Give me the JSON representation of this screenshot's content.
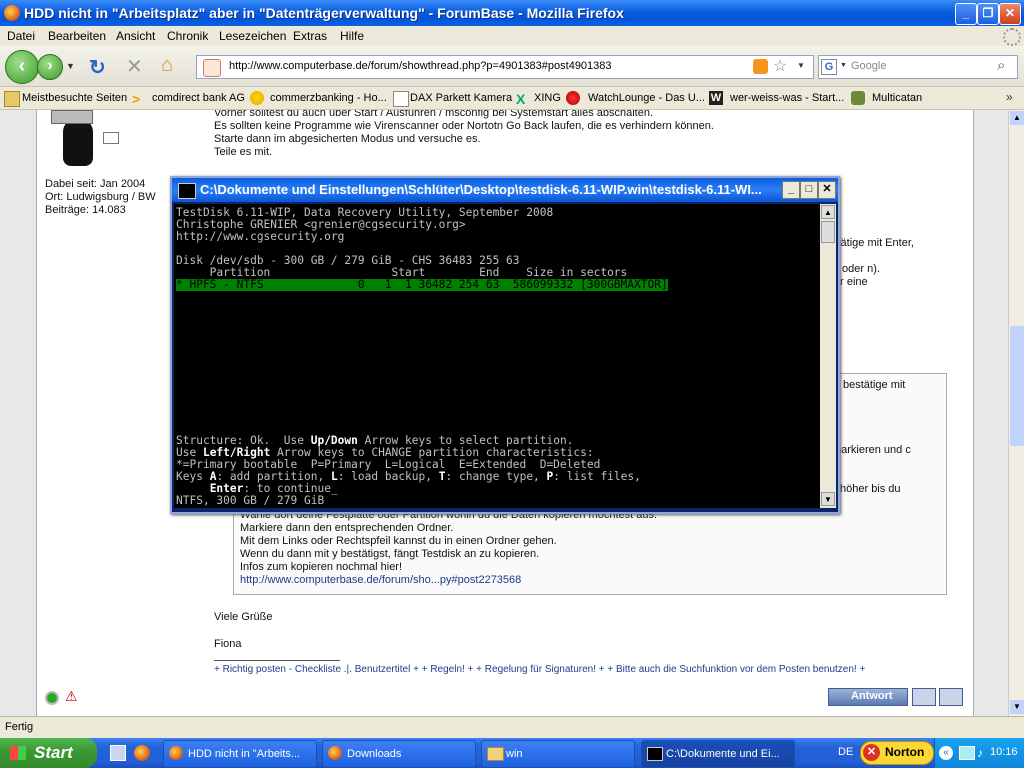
{
  "window": {
    "title": "HDD nicht in \"Arbeitsplatz\" aber in \"Datenträgerverwaltung\" - ForumBase - Mozilla Firefox"
  },
  "menu": [
    "Datei",
    "Bearbeiten",
    "Ansicht",
    "Chronik",
    "Lesezeichen",
    "Extras",
    "Hilfe"
  ],
  "nav": {
    "url": "http://www.computerbase.de/forum/showthread.php?p=4901383#post4901383",
    "search_placeholder": "Google"
  },
  "bookmarks": [
    "Meistbesuchte Seiten",
    "comdirect bank AG",
    "commerzbanking - Ho...",
    "DAX Parkett Kamera",
    "XING",
    "WatchLounge - Das U...",
    "wer-weiss-was - Start...",
    "Multicatan"
  ],
  "forum": {
    "user_joined": "Dabei seit: Jan 2004",
    "user_location": "Ort: Ludwigsburg / BW",
    "user_posts": "Beiträge: 14.083",
    "post_lines_top": [
      "Vorher solltest du auch über Start / Ausführen / msconfig bei Systemstart alles abschalten.",
      "Es sollten keine Programme wie Virenscanner oder Nortotn Go Back laufen, die es verhindern können.",
      "Starte dann im abgesicherten Modus und versuche es.",
      "Teile es mit."
    ],
    "partial_right": [
      "stätige mit Enter,",
      "oder n).",
      "er eine",
      "bestätige mit",
      "narkieren und c",
      "höher bis du"
    ],
    "quote_lines": [
      "Wähle dort deine Festplatte oder Partition wohin du die Daten kopieren möchtest aus.",
      "Markiere dann den entsprechenden Ordner.",
      "Mit dem Links oder Rechtspfeil kannst du in einen Ordner gehen.",
      "Wenn du dann mit y bestätigst, fängt Testdisk an zu kopieren.",
      "Infos zum kopieren nochmal hier!"
    ],
    "quote_link": "http://www.computerbase.de/forum/sho...py#post2273568",
    "greeting": "Viele Grüße",
    "signature": "Fiona",
    "footer_links": "+ Richtig posten - Checkliste .|. Benutzertitel + + Regeln! + + Regelung für Signaturen! + + Bitte auch die Suchfunktion vor dem Posten benutzen! +",
    "reply_button": "Antwort"
  },
  "console": {
    "title": "C:\\Dokumente und Einstellungen\\Schlüter\\Desktop\\testdisk-6.11-WIP.win\\testdisk-6.11-WI...",
    "line1": "TestDisk 6.11-WIP, Data Recovery Utility, September 2008",
    "line2": "Christophe GRENIER <grenier@cgsecurity.org>",
    "line3": "http://www.cgsecurity.org",
    "line4": "Disk /dev/sdb - 300 GB / 279 GiB - CHS 36483 255 63",
    "line5": "     Partition                  Start        End    Size in sectors",
    "selected_row": "* HPFS - NTFS              0   1  1 36482 254 63  586099332 [300GBMAXTOR]",
    "structure_a": "Structure: Ok.  Use ",
    "structure_b": "Up/Down",
    "structure_c": " Arrow keys to select partition.",
    "use_a": "Use ",
    "use_b": "Left/Right",
    "use_c": " Arrow keys to CHANGE partition characteristics:",
    "types": "*=Primary bootable  P=Primary  L=Logical  E=Extended  D=Deleted",
    "keys_a": "Keys ",
    "keys_b": "A",
    "keys_c": ": add partition, ",
    "keys_d": "L",
    "keys_e": ": load backup, ",
    "keys_f": "T",
    "keys_g": ": change type, ",
    "keys_h": "P",
    "keys_i": ": list files,",
    "enter_a": "     ",
    "enter_b": "Enter",
    "enter_c": ": to continue",
    "last": "NTFS, 300 GB / 279 GiB"
  },
  "status": "Fertig",
  "taskbar": {
    "start": "Start",
    "tasks": [
      "HDD nicht in \"Arbeits...",
      "Downloads",
      "win",
      "C:\\Dokumente und Ei..."
    ],
    "lang": "DE",
    "norton": "Norton",
    "clock": "10:16"
  }
}
